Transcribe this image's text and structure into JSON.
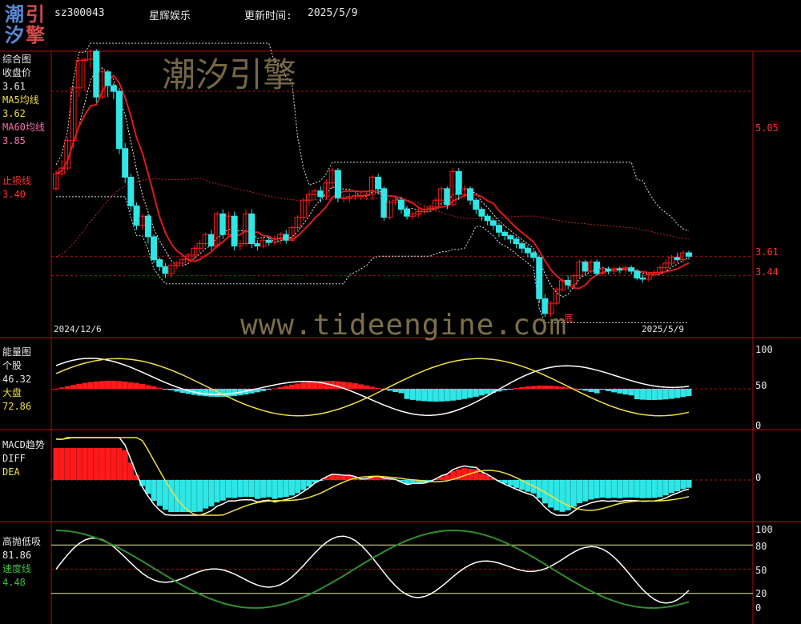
{
  "header": {
    "logo_chars": [
      "潮",
      "引",
      "汐",
      "擎"
    ],
    "stock_code": "sz300043",
    "stock_name": "星辉娱乐",
    "update_label": "更新时间:",
    "update_date": "2025/5/9"
  },
  "watermark": {
    "brand": "潮汐引擎",
    "url": "www.tideengine.com"
  },
  "colors": {
    "background": "#000000",
    "frame": "#b01010",
    "up": "#ff1a1a",
    "down": "#2ee6e6",
    "ma5": "#f0e040",
    "ma60": "#ff6fae",
    "stoploss": "#e01a1a",
    "speed": "#2f8f2f"
  },
  "chart_data": [
    {
      "panel": "main",
      "type": "candlestick",
      "title": "综合图",
      "legend": [
        {
          "name": "收盘价",
          "value": "3.61",
          "color": "#e6e6e6"
        },
        {
          "name": "MA5均线",
          "value": "3.62",
          "color": "#f0e040"
        },
        {
          "name": "MA60均线",
          "value": "3.85",
          "color": "#ff6fae"
        },
        {
          "name": "止损线",
          "value": "3.40",
          "color": "#ff3030"
        }
      ],
      "right_axis_labels": [
        "5.05",
        "3.61",
        "3.44"
      ],
      "x_labels": {
        "start": "2024/12/6",
        "end": "2025/5/9"
      },
      "annotation": "底",
      "ylim": [
        2.9,
        5.4
      ],
      "candles": [
        [
          4.2,
          4.33,
          4.18,
          4.36
        ],
        [
          4.33,
          4.38,
          4.3,
          4.45
        ],
        [
          4.38,
          4.62,
          4.36,
          4.65
        ],
        [
          4.62,
          5.08,
          4.55,
          5.1
        ],
        [
          5.08,
          5.32,
          5.0,
          5.34
        ],
        [
          5.32,
          5.33,
          5.05,
          5.34
        ],
        [
          5.33,
          5.4,
          5.25,
          5.42
        ],
        [
          5.4,
          5.0,
          4.95,
          5.42
        ],
        [
          5.0,
          5.22,
          4.98,
          5.25
        ],
        [
          5.22,
          5.1,
          5.0,
          5.24
        ],
        [
          5.1,
          5.05,
          4.98,
          5.12
        ],
        [
          5.05,
          4.55,
          4.5,
          5.08
        ],
        [
          4.55,
          4.3,
          4.25,
          4.6
        ],
        [
          4.3,
          4.05,
          4.0,
          4.33
        ],
        [
          4.05,
          3.88,
          3.84,
          4.08
        ],
        [
          3.88,
          3.96,
          3.84,
          3.98
        ],
        [
          3.96,
          3.78,
          3.72,
          3.98
        ],
        [
          3.78,
          3.58,
          3.55,
          3.8
        ],
        [
          3.58,
          3.52,
          3.48,
          3.6
        ],
        [
          3.52,
          3.46,
          3.42,
          3.55
        ],
        [
          3.46,
          3.53,
          3.42,
          3.55
        ],
        [
          3.53,
          3.55,
          3.5,
          3.57
        ],
        [
          3.55,
          3.58,
          3.52,
          3.6
        ],
        [
          3.58,
          3.62,
          3.55,
          3.64
        ],
        [
          3.62,
          3.68,
          3.58,
          3.7
        ],
        [
          3.68,
          3.72,
          3.64,
          3.75
        ],
        [
          3.72,
          3.8,
          3.7,
          3.82
        ],
        [
          3.8,
          3.7,
          3.66,
          3.84
        ],
        [
          3.7,
          3.98,
          3.68,
          4.0
        ],
        [
          3.98,
          3.8,
          3.76,
          4.02
        ],
        [
          3.8,
          3.96,
          3.78,
          4.0
        ],
        [
          3.96,
          3.7,
          3.66,
          4.0
        ],
        [
          3.7,
          3.72,
          3.66,
          3.75
        ],
        [
          3.72,
          3.98,
          3.7,
          4.02
        ],
        [
          3.98,
          3.72,
          3.68,
          4.02
        ],
        [
          3.72,
          3.7,
          3.66,
          3.75
        ],
        [
          3.7,
          3.75,
          3.68,
          3.78
        ],
        [
          3.75,
          3.73,
          3.7,
          3.78
        ],
        [
          3.73,
          3.76,
          3.7,
          3.79
        ],
        [
          3.76,
          3.8,
          3.72,
          3.82
        ],
        [
          3.8,
          3.75,
          3.72,
          3.84
        ],
        [
          3.75,
          3.86,
          3.73,
          3.88
        ],
        [
          3.86,
          3.95,
          3.82,
          3.97
        ],
        [
          3.95,
          4.1,
          3.92,
          4.12
        ],
        [
          4.1,
          4.15,
          4.05,
          4.18
        ],
        [
          4.15,
          4.18,
          4.1,
          4.2
        ],
        [
          4.18,
          4.13,
          4.08,
          4.22
        ],
        [
          4.13,
          4.25,
          4.1,
          4.28
        ],
        [
          4.25,
          4.36,
          4.2,
          4.38
        ],
        [
          4.36,
          4.12,
          4.08,
          4.38
        ],
        [
          4.12,
          4.12,
          4.08,
          4.15
        ],
        [
          4.12,
          4.13,
          4.08,
          4.16
        ],
        [
          4.13,
          4.14,
          4.1,
          4.17
        ],
        [
          4.14,
          4.14,
          4.1,
          4.17
        ],
        [
          4.14,
          4.15,
          4.1,
          4.18
        ],
        [
          4.15,
          4.3,
          4.1,
          4.32
        ],
        [
          4.3,
          4.2,
          4.15,
          4.33
        ],
        [
          4.2,
          3.95,
          3.92,
          4.22
        ],
        [
          3.95,
          4.08,
          3.93,
          4.1
        ],
        [
          4.08,
          4.1,
          4.05,
          4.13
        ],
        [
          4.1,
          4.02,
          3.98,
          4.13
        ],
        [
          4.02,
          3.96,
          3.93,
          4.05
        ],
        [
          3.96,
          3.98,
          3.93,
          4.0
        ],
        [
          3.98,
          4.0,
          3.95,
          4.03
        ],
        [
          4.0,
          4.02,
          3.98,
          4.05
        ],
        [
          4.02,
          4.04,
          3.99,
          4.06
        ],
        [
          4.04,
          4.1,
          4.0,
          4.12
        ],
        [
          4.1,
          4.2,
          4.05,
          4.22
        ],
        [
          4.2,
          4.06,
          4.02,
          4.22
        ],
        [
          4.06,
          4.35,
          4.04,
          4.38
        ],
        [
          4.35,
          4.15,
          4.1,
          4.38
        ],
        [
          4.15,
          4.2,
          4.12,
          4.23
        ],
        [
          4.2,
          4.1,
          4.06,
          4.22
        ],
        [
          4.1,
          4.02,
          3.98,
          4.12
        ],
        [
          4.02,
          3.96,
          3.92,
          4.04
        ],
        [
          3.96,
          3.92,
          3.88,
          3.98
        ],
        [
          3.92,
          3.88,
          3.84,
          3.94
        ],
        [
          3.88,
          3.82,
          3.78,
          3.9
        ],
        [
          3.82,
          3.79,
          3.75,
          3.84
        ],
        [
          3.79,
          3.76,
          3.72,
          3.8
        ],
        [
          3.76,
          3.72,
          3.68,
          3.78
        ],
        [
          3.72,
          3.68,
          3.64,
          3.74
        ],
        [
          3.68,
          3.64,
          3.6,
          3.7
        ],
        [
          3.64,
          3.6,
          3.56,
          3.66
        ],
        [
          3.6,
          3.24,
          3.2,
          3.62
        ],
        [
          3.24,
          3.11,
          3.08,
          3.28
        ],
        [
          3.11,
          3.2,
          3.08,
          3.22
        ],
        [
          3.2,
          3.32,
          3.18,
          3.34
        ],
        [
          3.32,
          3.4,
          3.3,
          3.42
        ],
        [
          3.4,
          3.36,
          3.32,
          3.44
        ],
        [
          3.36,
          3.44,
          3.33,
          3.46
        ],
        [
          3.44,
          3.56,
          3.42,
          3.58
        ],
        [
          3.56,
          3.48,
          3.45,
          3.58
        ],
        [
          3.48,
          3.56,
          3.46,
          3.58
        ],
        [
          3.56,
          3.46,
          3.44,
          3.58
        ],
        [
          3.46,
          3.5,
          3.44,
          3.52
        ],
        [
          3.5,
          3.48,
          3.45,
          3.52
        ],
        [
          3.48,
          3.5,
          3.45,
          3.52
        ],
        [
          3.5,
          3.49,
          3.46,
          3.52
        ],
        [
          3.49,
          3.51,
          3.46,
          3.53
        ],
        [
          3.51,
          3.48,
          3.45,
          3.53
        ],
        [
          3.48,
          3.42,
          3.4,
          3.5
        ],
        [
          3.42,
          3.41,
          3.38,
          3.45
        ],
        [
          3.41,
          3.45,
          3.39,
          3.47
        ],
        [
          3.45,
          3.47,
          3.43,
          3.49
        ],
        [
          3.47,
          3.51,
          3.45,
          3.53
        ],
        [
          3.51,
          3.55,
          3.48,
          3.58
        ],
        [
          3.55,
          3.6,
          3.52,
          3.62
        ],
        [
          3.6,
          3.58,
          3.56,
          3.64
        ],
        [
          3.58,
          3.64,
          3.56,
          3.66
        ],
        [
          3.64,
          3.61,
          3.58,
          3.66
        ]
      ]
    },
    {
      "panel": "energy",
      "type": "bar+line",
      "title": "能量图",
      "legend": [
        {
          "name": "个股",
          "value": "46.32",
          "color": "#e6e6e6"
        },
        {
          "name": "大盘",
          "value": "72.86",
          "color": "#f0e040"
        }
      ],
      "right_axis_labels": [
        "100",
        "50",
        "0"
      ],
      "ylim": [
        0,
        100
      ]
    },
    {
      "panel": "macd",
      "type": "bar+line",
      "title": "MACD趋势",
      "legend": [
        {
          "name": "DIFF",
          "value": "",
          "color": "#e6e6e6"
        },
        {
          "name": "DEA",
          "value": "",
          "color": "#f0e040"
        }
      ],
      "right_axis_labels": [
        "0"
      ]
    },
    {
      "panel": "high_low",
      "type": "line",
      "title": "高抛低吸",
      "legend": [
        {
          "name": "",
          "value": "81.86",
          "color": "#e6e6e6"
        },
        {
          "name": "速度线",
          "value": "4.48",
          "color": "#2f8f2f"
        }
      ],
      "right_axis_labels": [
        "100",
        "80",
        "50",
        "20",
        "0"
      ],
      "ylim": [
        0,
        100
      ]
    }
  ]
}
